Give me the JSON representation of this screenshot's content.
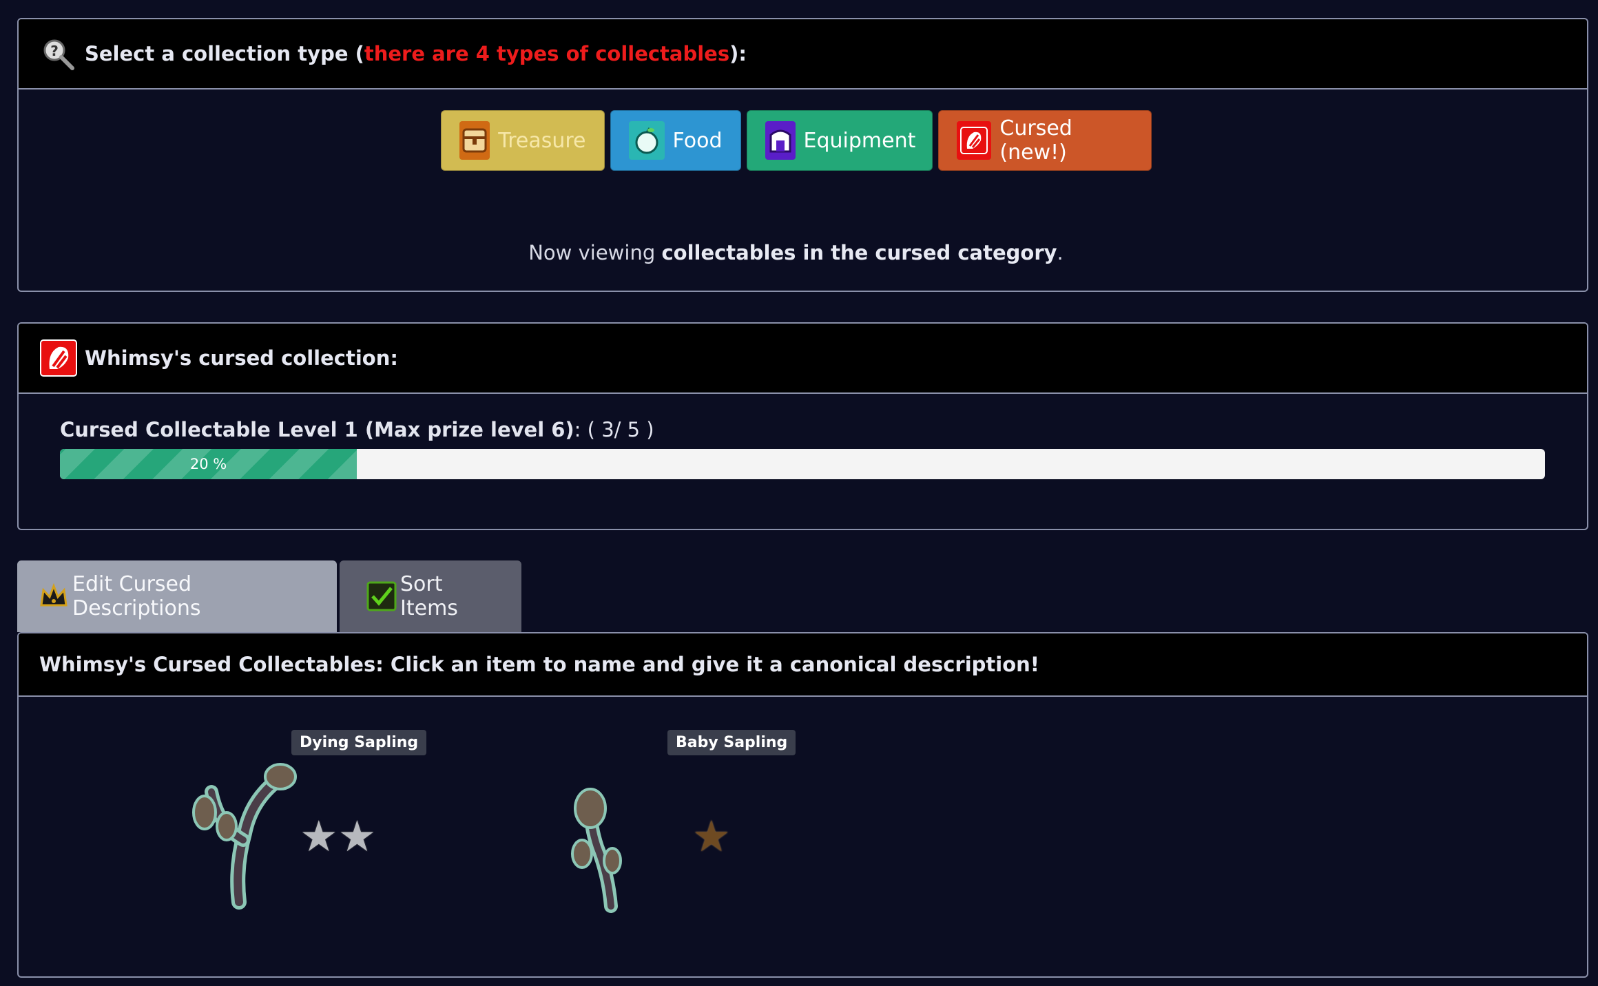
{
  "type_panel": {
    "title_prefix": "Select a collection type (",
    "title_highlight": "there are 4 types of collectables",
    "title_suffix": "):",
    "buttons": [
      {
        "label": "Treasure",
        "color": "#d2bb52",
        "icon": "treasure-chest-icon"
      },
      {
        "label": "Food",
        "color": "#2d95d2",
        "icon": "apple-icon"
      },
      {
        "label": "Equipment",
        "color": "#23a878",
        "icon": "armor-icon"
      },
      {
        "label": "Cursed (new!)",
        "color": "#cc5628",
        "icon": "cursed-icon"
      }
    ],
    "viewing_prefix": "Now viewing ",
    "viewing_bold": "collectables in the ",
    "viewing_highlight": "cursed",
    "viewing_bold2": " category",
    "viewing_suffix": "."
  },
  "collection_panel": {
    "title": "Whimsy's cursed collection:",
    "level_label": "Cursed Collectable Level 1 (Max prize level 6)",
    "level_count": ": ( 3/ 5 )",
    "progress_text": "20 %",
    "progress_value": 0.2
  },
  "tabs": [
    {
      "label": "Edit Cursed Descriptions",
      "icon": "crown-icon"
    },
    {
      "label": "Sort Items",
      "icon": "checkbox-icon"
    }
  ],
  "items_panel": {
    "title": "Whimsy's Cursed Collectables: Click an item to name and give it a canonical description!",
    "items": [
      {
        "name": "Dying Sapling",
        "stars": 2,
        "star_type": "silver"
      },
      {
        "name": "Baby Sapling",
        "stars": 1,
        "star_type": "bronze"
      }
    ]
  }
}
